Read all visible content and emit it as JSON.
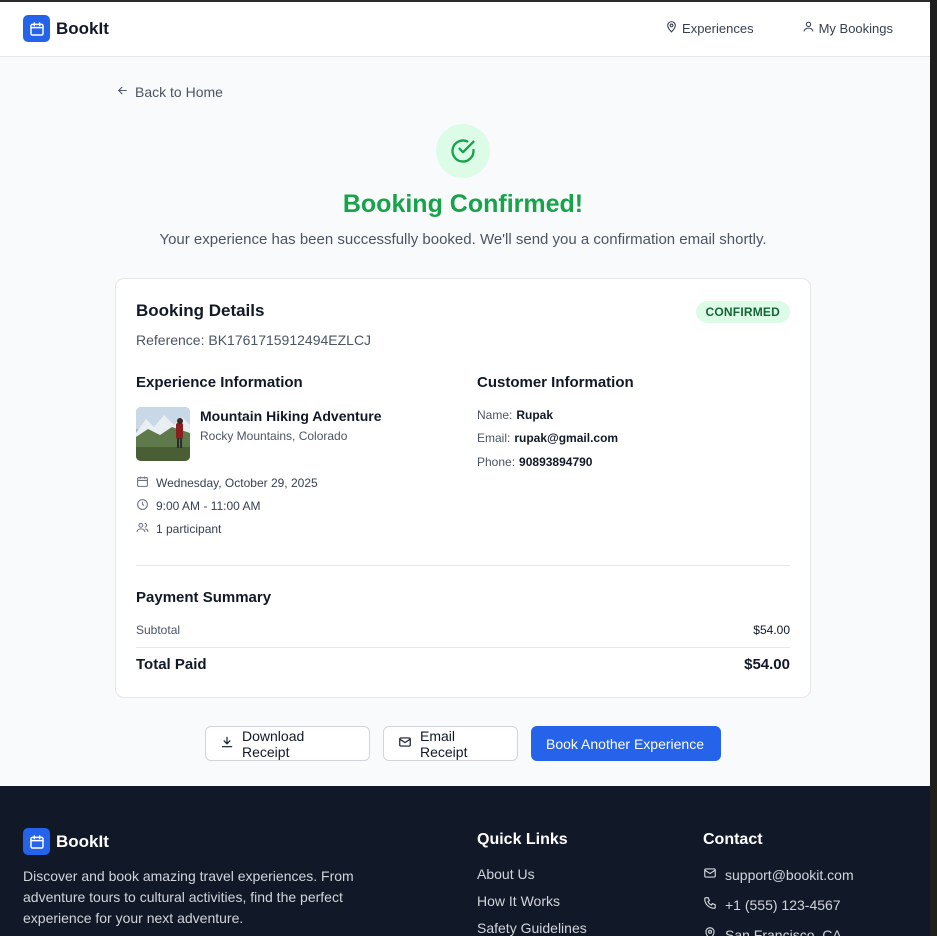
{
  "header": {
    "brand": "BookIt",
    "nav": [
      {
        "label": "Experiences",
        "icon": "map-pin-icon"
      },
      {
        "label": "My Bookings",
        "icon": "user-icon"
      }
    ]
  },
  "back_link": "Back to Home",
  "hero": {
    "title": "Booking Confirmed!",
    "subtitle": "Your experience has been successfully booked. We'll send you a confirmation email shortly."
  },
  "booking": {
    "heading": "Booking Details",
    "status": "CONFIRMED",
    "reference": "Reference: BK1761715912494EZLCJ",
    "experience": {
      "heading": "Experience Information",
      "name": "Mountain Hiking Adventure",
      "location": "Rocky Mountains, Colorado",
      "date": "Wednesday, October 29, 2025",
      "time": "9:00 AM - 11:00 AM",
      "participants": "1 participant"
    },
    "customer": {
      "heading": "Customer Information",
      "name_label": "Name:",
      "name": "Rupak",
      "email_label": "Email:",
      "email": "rupak@gmail.com",
      "phone_label": "Phone:",
      "phone": "90893894790"
    },
    "payment": {
      "heading": "Payment Summary",
      "subtotal_label": "Subtotal",
      "subtotal": "$54.00",
      "total_label": "Total Paid",
      "total": "$54.00"
    }
  },
  "actions": {
    "download": "Download Receipt",
    "email": "Email Receipt",
    "book_another": "Book Another Experience"
  },
  "footer": {
    "brand": "BookIt",
    "description": "Discover and book amazing travel experiences. From adventure tours to cultural activities, find the perfect experience for your next adventure.",
    "quick_links_heading": "Quick Links",
    "quick_links": [
      "About Us",
      "How It Works",
      "Safety Guidelines"
    ],
    "contact_heading": "Contact",
    "email": "support@bookit.com",
    "phone": "+1 (555) 123-4567",
    "address": "San Francisco, CA"
  },
  "colors": {
    "primary": "#2563eb",
    "success": "#16a34a",
    "success_bg": "#dcfce7",
    "footer_bg": "#111827"
  }
}
